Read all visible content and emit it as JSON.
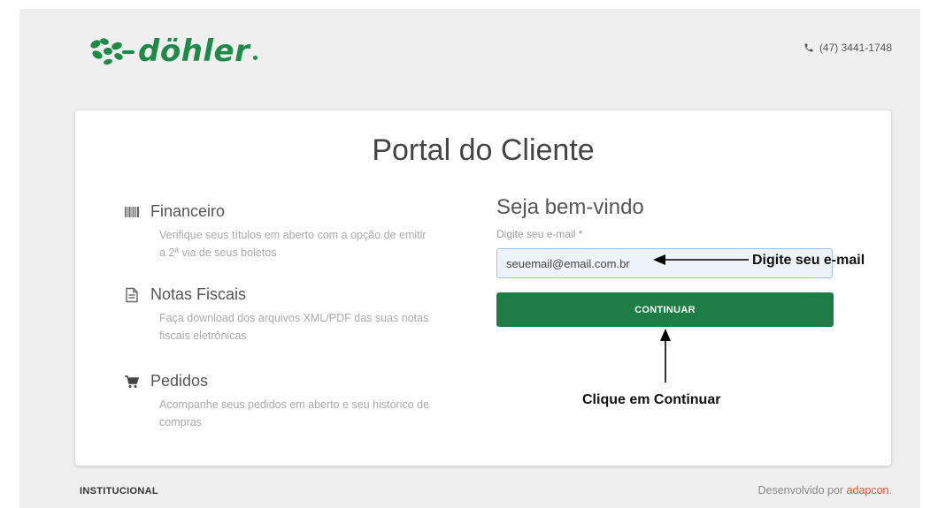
{
  "header": {
    "logo_text": "döhler",
    "phone": "(47) 3441-1748"
  },
  "card": {
    "title": "Portal do Cliente",
    "features": [
      {
        "icon": "barcode-icon",
        "title": "Financeiro",
        "description": "Verifique seus títulos em aberto com a opção de emitir a 2ª via de seus boletos"
      },
      {
        "icon": "document-icon",
        "title": "Notas Fiscais",
        "description": "Faça download dos arquivos XML/PDF das suas notas fiscais eletrônicas"
      },
      {
        "icon": "cart-icon",
        "title": "Pedidos",
        "description": "Acompanhe seus pedidos em aberto e seu histórico de compras"
      }
    ],
    "login": {
      "welcome": "Seja bem-vindo",
      "email_label": "Digite seu e-mail *",
      "email_value": "seuemail@email.com.br",
      "continue_label": "CONTINUAR"
    }
  },
  "annotations": {
    "email_hint": "Digite seu e-mail",
    "continue_hint": "Clique em Continuar"
  },
  "footer": {
    "left": "INSTITUCIONAL",
    "right_prefix": "Desenvolvido por ",
    "right_brand": "adapcon",
    "right_suffix": "."
  },
  "colors": {
    "brand_green": "#1d8a4a",
    "button_green": "#1e7d45",
    "footer_brand": "#e7533a"
  }
}
